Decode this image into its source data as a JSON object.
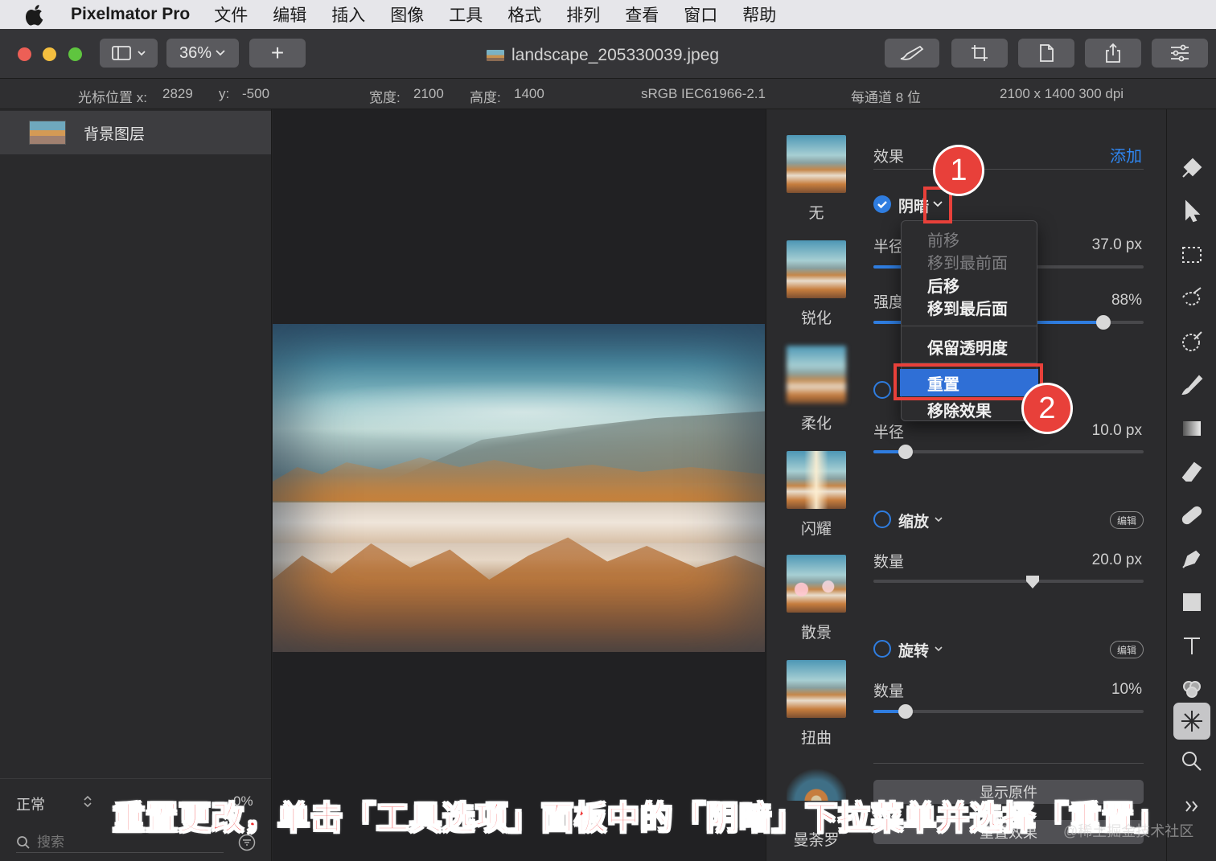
{
  "menubar": {
    "app_name": "Pixelmator Pro",
    "items": [
      "文件",
      "编辑",
      "插入",
      "图像",
      "工具",
      "格式",
      "排列",
      "查看",
      "窗口",
      "帮助"
    ]
  },
  "toolbar": {
    "zoom": "36%",
    "add_label": "+",
    "document_title": "landscape_205330039.jpeg"
  },
  "infobar": {
    "cursor_label": "光标位置 x:",
    "cursor_x": "2829",
    "cursor_y_label": "y:",
    "cursor_y": "-500",
    "width_label": "宽度:",
    "width": "2100",
    "height_label": "高度:",
    "height": "1400",
    "color_profile": "sRGB IEC61966-2.1",
    "bit_depth": "每通道 8 位",
    "dimensions": "2100 x 1400 300 dpi"
  },
  "layers": {
    "items": [
      {
        "name": "背景图层"
      }
    ],
    "blend_mode": "正常",
    "opacity_fragment": "0%",
    "search_placeholder": "搜索"
  },
  "effects_browser": {
    "items": [
      "无",
      "锐化",
      "柔化",
      "闪耀",
      "散景",
      "扭曲",
      "曼荼罗"
    ]
  },
  "fx_panel": {
    "header": "效果",
    "add_label": "添加",
    "shadow": {
      "name": "阴暗",
      "radius_label": "半径",
      "radius_value": "37.0 px",
      "strength_label": "强度",
      "strength_value": "88%",
      "strength_pct": 0.85
    },
    "second": {
      "radius_label": "半径",
      "radius_value": "10.0 px",
      "radius_pct": 0.12
    },
    "zoom": {
      "name": "缩放",
      "edit_label": "编辑",
      "amount_label": "数量",
      "amount_value": "20.0 px",
      "amount_pct": 0.59
    },
    "rotate": {
      "name": "旋转",
      "edit_label": "编辑",
      "amount_label": "数量",
      "amount_value": "10%",
      "amount_pct": 0.12
    },
    "show_original": "显示原件",
    "reset_effects": "重置效果"
  },
  "context_menu": {
    "move_forward": "前移",
    "bring_to_front": "移到最前面",
    "move_backward": "后移",
    "send_to_back": "移到最后面",
    "preserve_transparency": "保留透明度",
    "reset": "重置",
    "remove_effect": "移除效果"
  },
  "annotations": {
    "step1": "1",
    "step2": "2",
    "caption": "重置更改，单击「工具选项」面板中的「阴暗」下拉菜单并选择「重置」",
    "watermark": "@稀土掘金技术社区"
  },
  "colors": {
    "accent": "#2f7de0",
    "annotation_red": "#e8403a",
    "menu_highlight": "#2f6fd6"
  }
}
